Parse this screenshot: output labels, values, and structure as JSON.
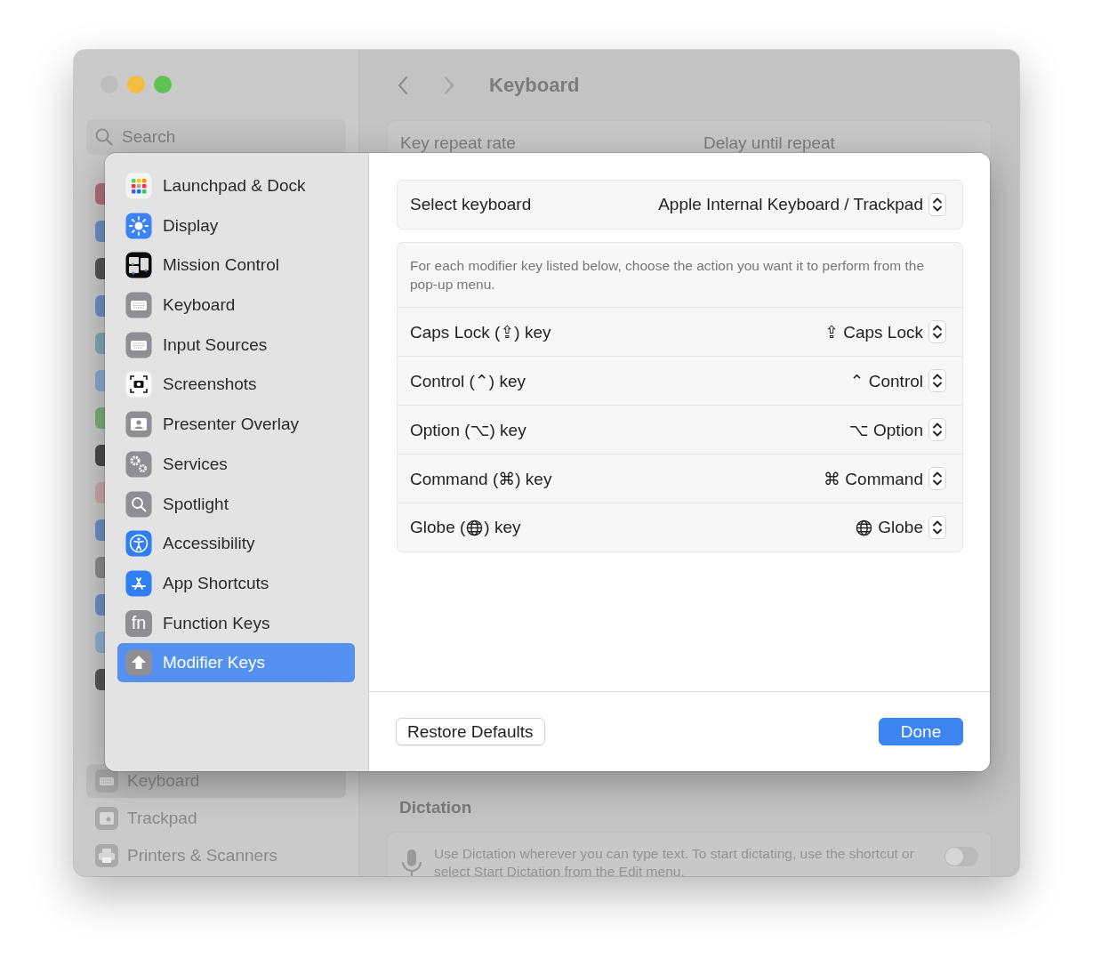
{
  "window": {
    "search": {
      "placeholder": "Search"
    },
    "sidebar": {
      "items": [
        {
          "label": "Keyboard",
          "selected": true
        },
        {
          "label": "Trackpad",
          "selected": false
        },
        {
          "label": "Printers & Scanners",
          "selected": false
        }
      ]
    },
    "title": "Keyboard",
    "key_repeat": {
      "rate_label": "Key repeat rate",
      "delay_label": "Delay until repeat"
    },
    "dictation": {
      "heading": "Dictation",
      "description": "Use Dictation wherever you can type text. To start dictating, use the shortcut or select Start Dictation from the Edit menu.",
      "on": false
    }
  },
  "sheet": {
    "sidebar": {
      "items": [
        {
          "label": "Launchpad & Dock",
          "selected": false
        },
        {
          "label": "Display",
          "selected": false
        },
        {
          "label": "Mission Control",
          "selected": false
        },
        {
          "label": "Keyboard",
          "selected": false
        },
        {
          "label": "Input Sources",
          "selected": false
        },
        {
          "label": "Screenshots",
          "selected": false
        },
        {
          "label": "Presenter Overlay",
          "selected": false
        },
        {
          "label": "Services",
          "selected": false
        },
        {
          "label": "Spotlight",
          "selected": false
        },
        {
          "label": "Accessibility",
          "selected": false
        },
        {
          "label": "App Shortcuts",
          "selected": false
        },
        {
          "label": "Function Keys",
          "icon_text": "fn",
          "selected": false
        },
        {
          "label": "Modifier Keys",
          "selected": true
        }
      ]
    },
    "select_keyboard": {
      "label": "Select keyboard",
      "value": "Apple Internal Keyboard / Trackpad"
    },
    "description": "For each modifier key listed below, choose the action you want it to perform from the pop-up menu.",
    "modifier_keys": [
      {
        "kind": "glyph",
        "label": "Caps Lock (⇪) key",
        "value": "⇪ Caps Lock"
      },
      {
        "kind": "glyph",
        "label": "Control (⌃) key",
        "value": "⌃ Control"
      },
      {
        "kind": "glyph",
        "label": "Option (⌥) key",
        "value": "⌥ Option"
      },
      {
        "kind": "glyph",
        "label": "Command (⌘) key",
        "value": "⌘ Command"
      },
      {
        "kind": "globe",
        "label_start": "Globe (",
        "label_end": ") key",
        "value": "Globe"
      }
    ],
    "buttons": {
      "restore": "Restore Defaults",
      "done": "Done"
    }
  }
}
